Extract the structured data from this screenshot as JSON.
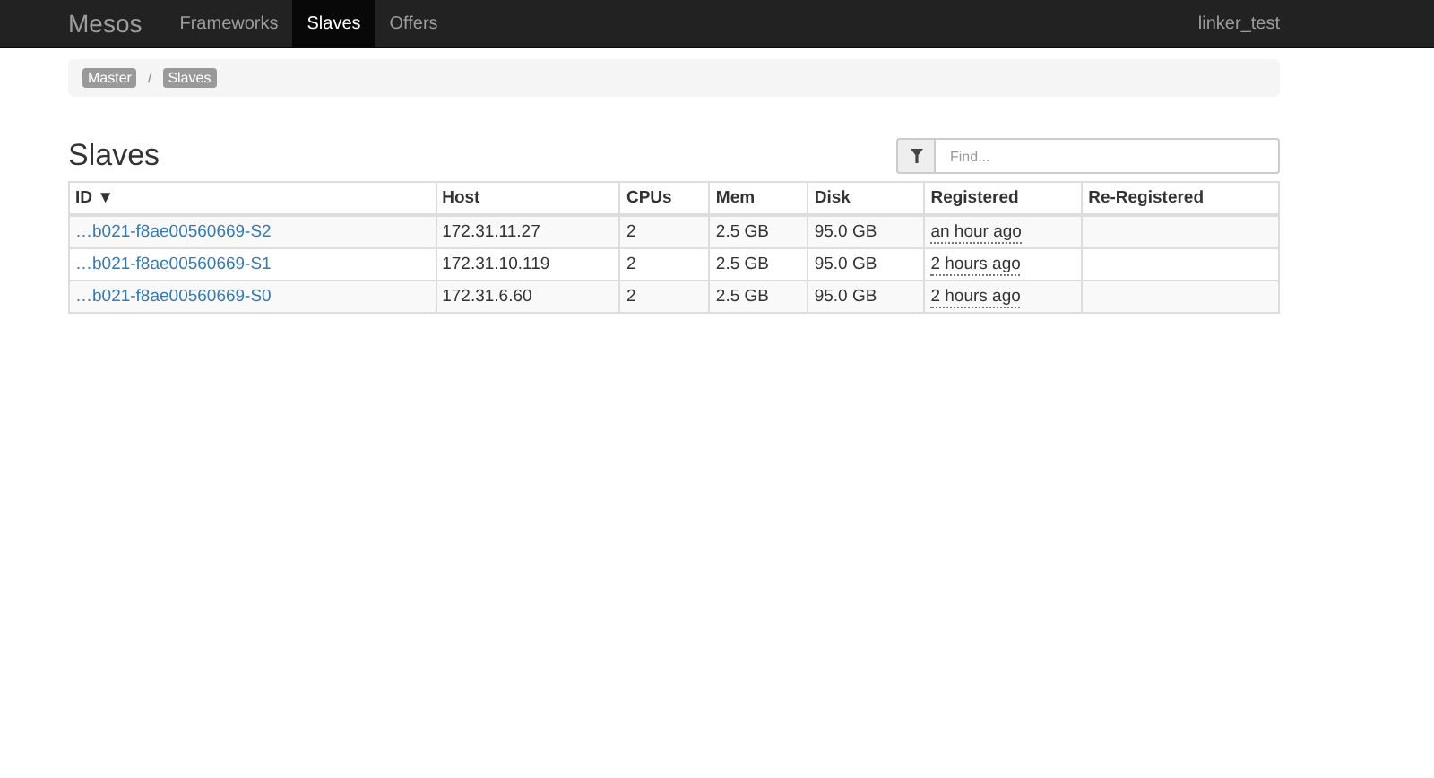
{
  "navbar": {
    "brand": "Mesos",
    "items": [
      {
        "label": "Frameworks",
        "selected": false
      },
      {
        "label": "Slaves",
        "selected": true
      },
      {
        "label": "Offers",
        "selected": false
      }
    ],
    "user": "linker_test"
  },
  "breadcrumb": [
    "Master",
    "Slaves"
  ],
  "breadcrumb_separator": "/",
  "title": "Slaves",
  "filter": {
    "placeholder": "Find..."
  },
  "table": {
    "columns": [
      {
        "label": "ID",
        "sort": "▼"
      },
      {
        "label": "Host"
      },
      {
        "label": "CPUs"
      },
      {
        "label": "Mem"
      },
      {
        "label": "Disk"
      },
      {
        "label": "Registered"
      },
      {
        "label": "Re-Registered"
      }
    ],
    "rows": [
      {
        "id": "…b021-f8ae00560669-S2",
        "host": "172.31.11.27",
        "cpus": "2",
        "mem": "2.5 GB",
        "disk": "95.0 GB",
        "registered": "an hour ago"
      },
      {
        "id": "…b021-f8ae00560669-S1",
        "host": "172.31.10.119",
        "cpus": "2",
        "mem": "2.5 GB",
        "disk": "95.0 GB",
        "registered": "2 hours ago"
      },
      {
        "id": "…b021-f8ae00560669-S0",
        "host": "172.31.6.60",
        "cpus": "2",
        "mem": "2.5 GB",
        "disk": "95.0 GB",
        "registered": "2 hours ago"
      }
    ]
  }
}
